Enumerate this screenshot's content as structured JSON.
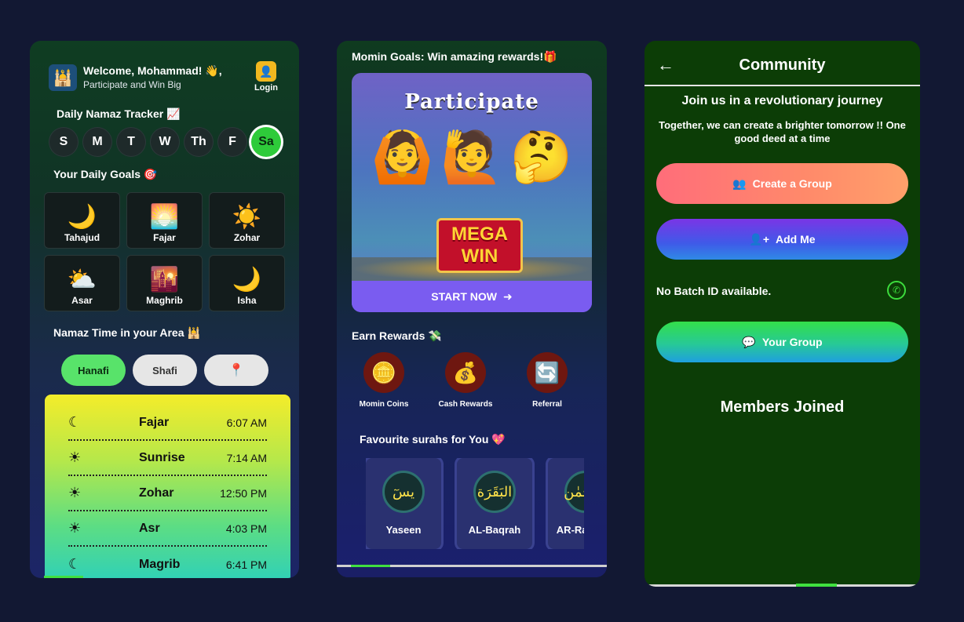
{
  "phone1": {
    "welcome": "Welcome, Mohammad! 👋,",
    "subtitle": "Participate and Win Big",
    "login_label": "Login",
    "tracker_title": "Daily Namaz Tracker 📈",
    "days": [
      "S",
      "M",
      "T",
      "W",
      "Th",
      "F",
      "Sa"
    ],
    "active_day": "Sa",
    "goals_title": "Your Daily Goals 🎯",
    "goals": [
      {
        "label": "Tahajud",
        "icon": "🌙"
      },
      {
        "label": "Fajar",
        "icon": "🌅"
      },
      {
        "label": "Zohar",
        "icon": "☀️"
      },
      {
        "label": "Asar",
        "icon": "⛅"
      },
      {
        "label": "Maghrib",
        "icon": "🌇"
      },
      {
        "label": "Isha",
        "icon": "🌙"
      }
    ],
    "area_title": "Namaz Time in your Area 🕌",
    "madhab": [
      "Hanafi",
      "Shafi"
    ],
    "active_madhab": "Hanafi",
    "times": [
      {
        "name": "Fajar",
        "time": "6:07 AM",
        "icon": "☾"
      },
      {
        "name": "Sunrise",
        "time": "7:14 AM",
        "icon": "☀"
      },
      {
        "name": "Zohar",
        "time": "12:50 PM",
        "icon": "☀"
      },
      {
        "name": "Asr",
        "time": "4:03 PM",
        "icon": "☀"
      },
      {
        "name": "Magrib",
        "time": "6:41 PM",
        "icon": "☾"
      }
    ]
  },
  "phone2": {
    "title": "Momin Goals: Win amazing rewards!🎁",
    "banner_title": "Participate",
    "banner_badge": "MEGA WIN",
    "start_label": "START NOW",
    "rewards_title": "Earn Rewards 💸",
    "rewards": [
      {
        "label": "Momin Coins",
        "icon": "🪙"
      },
      {
        "label": "Cash Rewards",
        "icon": "💰"
      },
      {
        "label": "Referral",
        "icon": "🔄"
      }
    ],
    "surahs_title": "Favourite surahs for You 💖",
    "surahs": [
      {
        "label": "Yaseen",
        "arabic": "يسٓ"
      },
      {
        "label": "AL-Baqrah",
        "arabic": "البَقَرَة"
      },
      {
        "label": "AR-Rahman",
        "arabic": "الرَّحْمٰن"
      }
    ]
  },
  "phone3": {
    "title": "Community",
    "heading": "Join us in a revolutionary journey",
    "subheading": "Together, we can create a brighter tomorrow  !! One good deed at a time",
    "create_label": "Create a Group",
    "add_label": "Add Me",
    "batch_text": "No Batch ID available.",
    "group_label": "Your Group",
    "members_title": "Members Joined"
  }
}
